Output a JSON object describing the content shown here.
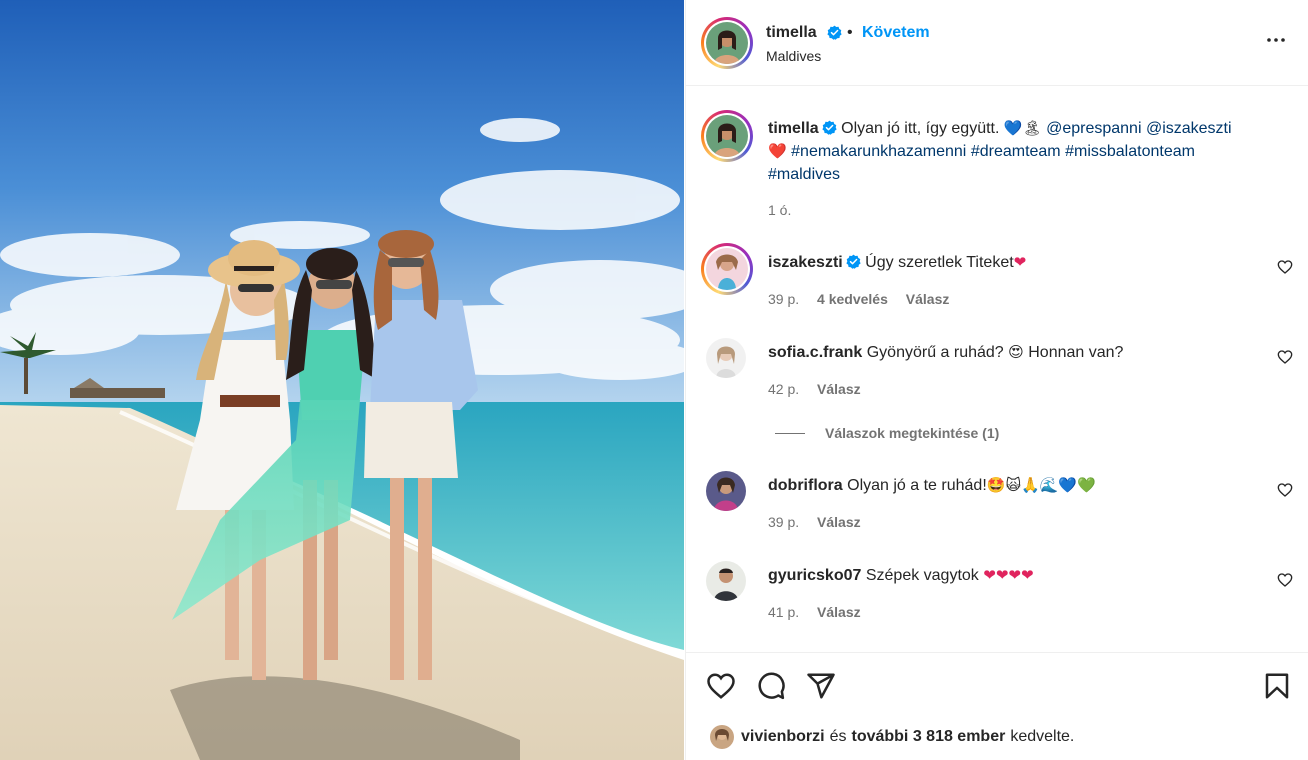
{
  "post": {
    "author": "timella",
    "follow_label": "Követem",
    "separator": "•",
    "location": "Maldives"
  },
  "caption": {
    "username": "timella",
    "text_start": "Olyan jó itt, így együtt.",
    "emoji_a": "💙",
    "emoji_b": "🏝",
    "mention_1": "@eprespanni",
    "mention_2": "@iszakeszti",
    "emoji_c": "❤️",
    "hashtag_1": "#nemakarunkhazamenni",
    "hashtag_2": "#dreamteam",
    "hashtag_3": "#missbalatonteam",
    "hashtag_4": "#maldives",
    "time": "1 ó."
  },
  "comments": [
    {
      "username": "iszakeszti",
      "verified": true,
      "text": "Úgy szeretlek Titeket",
      "emoji": "❤",
      "time": "39 p.",
      "likes": "4 kedvelés",
      "reply": "Válasz"
    },
    {
      "username": "sofia.c.frank",
      "verified": false,
      "text": "Gyönyörű a ruhád?",
      "emoji": "😍",
      "text_end": "Honnan van?",
      "time": "42 p.",
      "reply": "Válasz"
    },
    {
      "username": "dobriflora",
      "verified": false,
      "text": "Olyan jó a te ruhád!",
      "emoji": "🤩🙀🙏🌊💙💚",
      "time": "39 p.",
      "reply": "Válasz"
    },
    {
      "username": "gyuricsko07",
      "verified": false,
      "text": "Szépek vagytok",
      "emoji": "❤❤❤❤",
      "time": "41 p.",
      "reply": "Válasz"
    }
  ],
  "view_replies": "Válaszok megtekintése (1)",
  "likes": {
    "user": "vivienborzi",
    "connector": "és",
    "others": "további 3 818 ember",
    "suffix": "kedvelte."
  },
  "icons": {
    "verified": "verified-badge-icon",
    "more": "more-options-icon",
    "like": "heart-icon",
    "comment": "comment-bubble-icon",
    "share": "paper-plane-icon",
    "save": "bookmark-icon"
  },
  "colors": {
    "accent": "#0095f6",
    "hashtag": "#00376b",
    "muted": "#737373",
    "text": "#262626"
  }
}
